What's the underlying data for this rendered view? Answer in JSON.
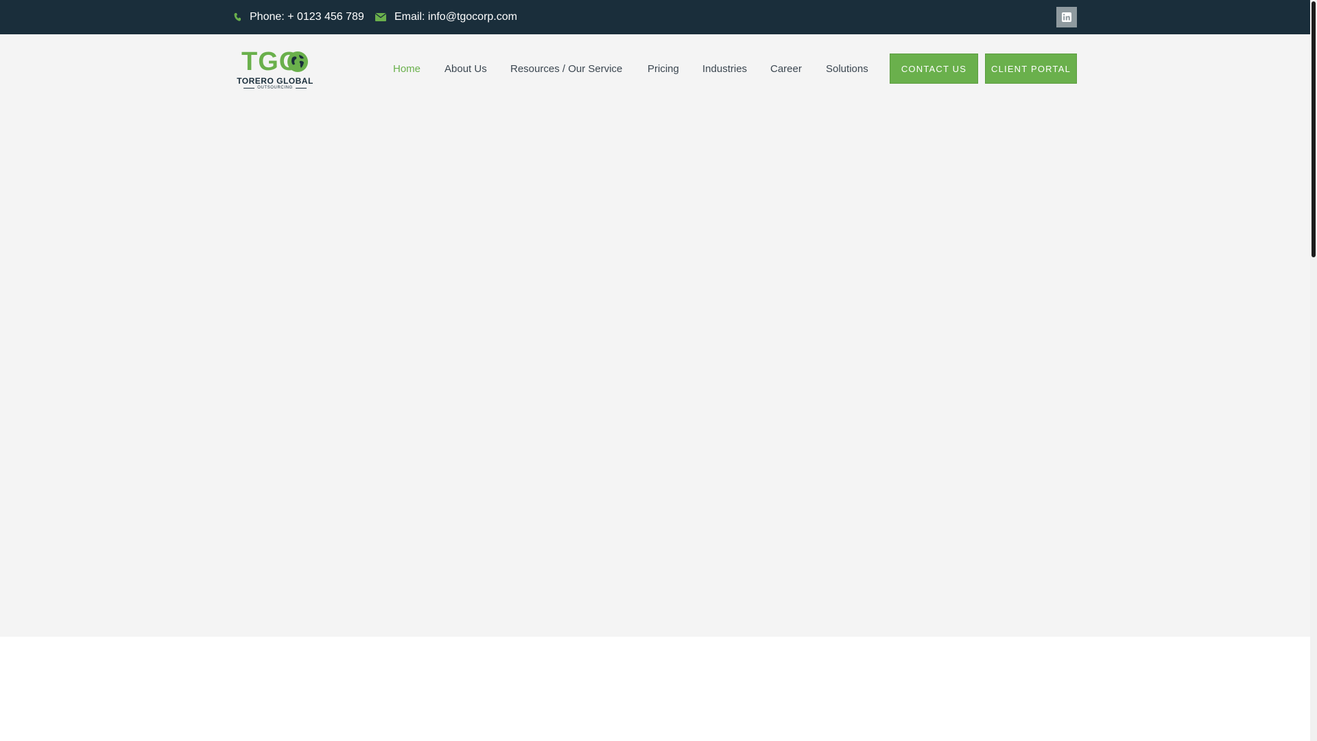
{
  "topbar": {
    "phone": "Phone: + 0123 456 789",
    "email": "Email: info@tgocorp.com",
    "social": [
      {
        "icon": "linkedin-icon"
      }
    ],
    "colors": {
      "background": "#1a2e3b",
      "accent": "#6ab04c"
    }
  },
  "logo": {
    "mark": "TGO",
    "name": "TORERO GLOBAL",
    "tagline": "OUTSOURCING"
  },
  "nav": {
    "items": [
      {
        "label": "Home",
        "active": true
      },
      {
        "label": "About Us"
      },
      {
        "label": "Resources / Our Service"
      },
      {
        "label": "Pricing"
      },
      {
        "label": "Industries"
      },
      {
        "label": "Career"
      },
      {
        "label": "Solutions"
      }
    ]
  },
  "actions": {
    "contact": "CONTACT US",
    "portal": "CLIENT PORTAL"
  },
  "colors": {
    "accent": "#6ab04c",
    "hero_background": "#f4f4f4",
    "text": "#3b4650"
  }
}
